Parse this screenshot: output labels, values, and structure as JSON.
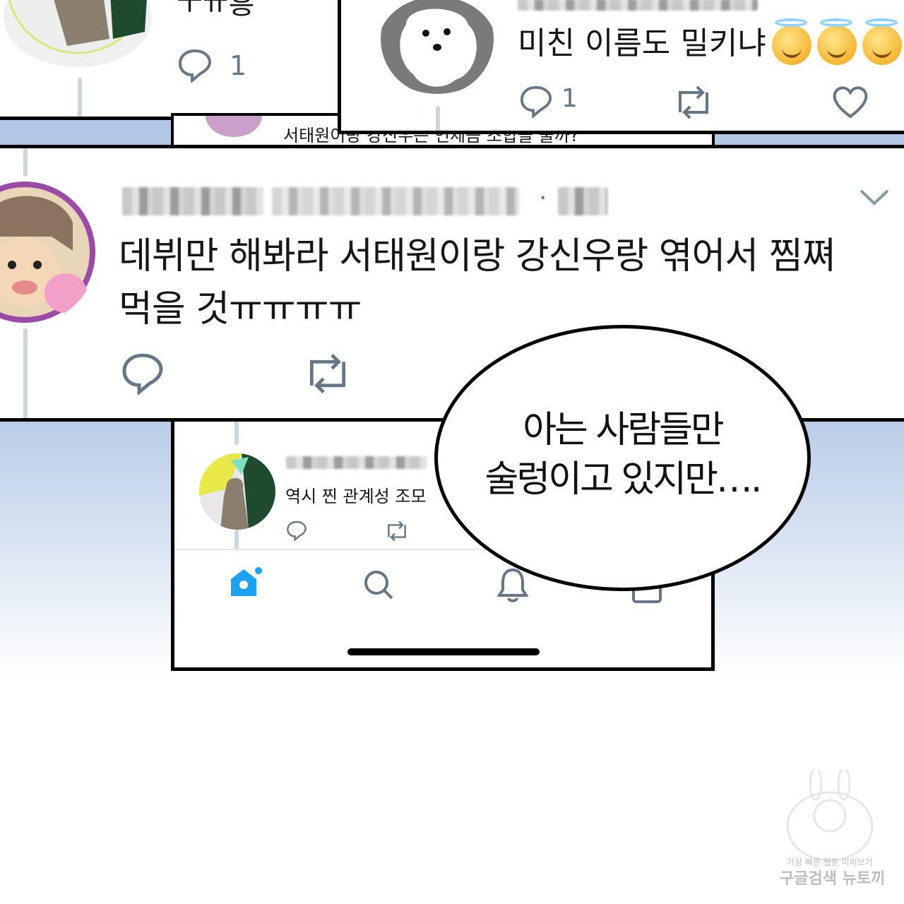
{
  "panel_top_right": {
    "tweet_text": "미친 이름도 밀키냐",
    "emojis": [
      "smiling-face-with-halo",
      "smiling-face-with-halo",
      "smiling-face-with-halo"
    ],
    "reply_count": "1"
  },
  "panel_top_left": {
    "partial_text": "ㅜㅠ흥",
    "reply_count": "1"
  },
  "hidden_strip": {
    "partial_text": "서태원이랑 강신우는 언제쯤 조합을 줄까?"
  },
  "panel_main": {
    "dot": "·",
    "tweet_line1": "데뷔만 해봐라 서태원이랑 강신우랑 엮어서 찜쪄",
    "tweet_line2": "먹을 것ㅠㅠㅠㅠ"
  },
  "panel_phone": {
    "tweet_text": "역시 찐 관계성 조모"
  },
  "speech_bubble": {
    "line1": "아는 사람들만",
    "line2": "술렁이고 있지만…."
  },
  "watermark": {
    "line1": "가장 빠른 웹툰 미리보기",
    "line2": "구글검색 뉴토끼"
  },
  "colors": {
    "twitter_blue": "#1da1f2",
    "icon_gray": "#657786",
    "background_blue": "#b3c7e6"
  }
}
